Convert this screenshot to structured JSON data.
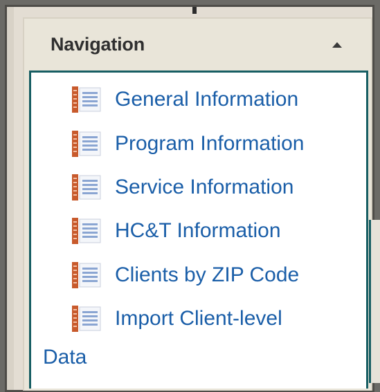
{
  "panel": {
    "title": "Navigation",
    "collapse_icon": "chevron-up-icon"
  },
  "nav": {
    "items": [
      {
        "label": "General Information",
        "icon": "report-icon"
      },
      {
        "label": "Program Information",
        "icon": "report-icon"
      },
      {
        "label": "Service Information",
        "icon": "report-icon"
      },
      {
        "label": "HC&T Information",
        "icon": "report-icon"
      },
      {
        "label": "Clients by ZIP Code",
        "icon": "report-icon"
      },
      {
        "label": "Import Client-level",
        "continuation": "Data",
        "icon": "report-icon"
      }
    ]
  },
  "colors": {
    "link": "#1a5ea8",
    "box_border": "#175e63",
    "panel_bg": "#e9e5d9",
    "frame_bg": "#e3ddd3",
    "icon_orange": "#c85a2c",
    "icon_blue": "#8aa5d2"
  }
}
